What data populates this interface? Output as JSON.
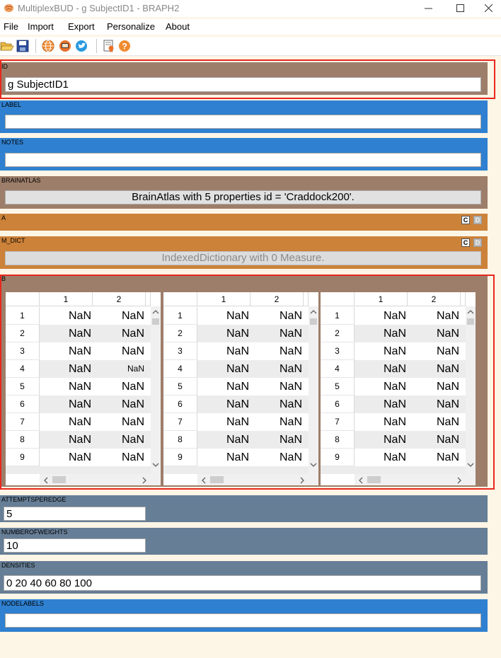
{
  "window": {
    "title": "MultiplexBUD - g SubjectID1 - BRAPH2"
  },
  "menu": [
    "File",
    "Import",
    "Export",
    "Personalize",
    "About"
  ],
  "colors": {
    "brown": "#9d7e6a",
    "blue": "#2f80d0",
    "orange": "#cc8239",
    "slate": "#667e96",
    "highlight": "#e8281e",
    "background": "#fdf5e6"
  },
  "icons": [
    "open-folder-icon",
    "save-icon",
    "globe-icon",
    "braph-icon",
    "twitter-icon",
    "license-icon",
    "help-icon"
  ],
  "panels": {
    "id": {
      "label": "ID",
      "value": "g SubjectID1"
    },
    "label": {
      "label": "LABEL",
      "value": ""
    },
    "notes": {
      "label": "NOTES",
      "value": ""
    },
    "brainatlas": {
      "label": "BRAINATLAS",
      "value": "BrainAtlas with 5 properties id = 'Craddock200'."
    },
    "a": {
      "label": "A",
      "c": "C",
      "d": "D"
    },
    "m_dict": {
      "label": "M_DICT",
      "value": "IndexedDictionary with 0 Measure.",
      "c": "C",
      "d": "D"
    },
    "b": {
      "label": "B",
      "tables": [
        {
          "col_headers": [
            "1",
            "2"
          ],
          "row_headers": [
            "1",
            "2",
            "3",
            "4",
            "5",
            "6",
            "7",
            "8",
            "9"
          ],
          "cells": [
            [
              "NaN",
              "NaN"
            ],
            [
              "NaN",
              "NaN"
            ],
            [
              "NaN",
              "NaN"
            ],
            [
              "NaN",
              "NaN"
            ],
            [
              "NaN",
              "NaN"
            ],
            [
              "NaN",
              "NaN"
            ],
            [
              "NaN",
              "NaN"
            ],
            [
              "NaN",
              "NaN"
            ],
            [
              "NaN",
              "NaN"
            ]
          ]
        },
        {
          "col_headers": [
            "1",
            "2"
          ],
          "row_headers": [
            "1",
            "2",
            "3",
            "4",
            "5",
            "6",
            "7",
            "8",
            "9"
          ],
          "cells": [
            [
              "NaN",
              "NaN"
            ],
            [
              "NaN",
              "NaN"
            ],
            [
              "NaN",
              "NaN"
            ],
            [
              "NaN",
              "NaN"
            ],
            [
              "NaN",
              "NaN"
            ],
            [
              "NaN",
              "NaN"
            ],
            [
              "NaN",
              "NaN"
            ],
            [
              "NaN",
              "NaN"
            ],
            [
              "NaN",
              "NaN"
            ]
          ]
        },
        {
          "col_headers": [
            "1",
            "2"
          ],
          "row_headers": [
            "1",
            "2",
            "3",
            "4",
            "5",
            "6",
            "7",
            "8",
            "9"
          ],
          "cells": [
            [
              "NaN",
              "NaN"
            ],
            [
              "NaN",
              "NaN"
            ],
            [
              "NaN",
              "NaN"
            ],
            [
              "NaN",
              "NaN"
            ],
            [
              "NaN",
              "NaN"
            ],
            [
              "NaN",
              "NaN"
            ],
            [
              "NaN",
              "NaN"
            ],
            [
              "NaN",
              "NaN"
            ],
            [
              "NaN",
              "NaN"
            ]
          ]
        }
      ]
    },
    "attemptsperedge": {
      "label": "ATTEMPTSPEREDGE",
      "value": "5"
    },
    "numberofweights": {
      "label": "NUMBEROFWEIGHTS",
      "value": "10"
    },
    "densities": {
      "label": "DENSITIES",
      "value": "0 20 40 60 80 100"
    },
    "nodelabels": {
      "label": "NODELABELS",
      "value": ""
    }
  }
}
